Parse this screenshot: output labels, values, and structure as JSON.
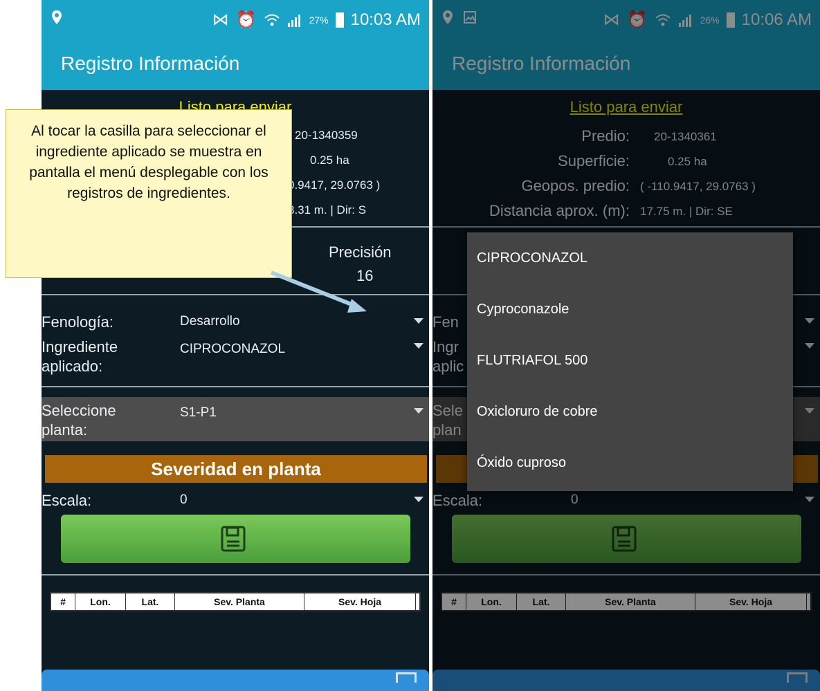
{
  "annotation": {
    "text": "Al tocar la casilla para seleccionar el ingrediente aplicado se muestra en pantalla el menú desplegable con los registros de ingredientes."
  },
  "phone1": {
    "status": {
      "battery": "27%",
      "time": "10:03 AM"
    },
    "app_title": "Registro Información",
    "ready_text": "Listo para enviar",
    "info": {
      "predio_value": "20-1340359",
      "superficie_value": "0.25 ha",
      "geopos_value": "0.9417, 29.0763 )",
      "distancia_value": "8.31 m. | Dir: S"
    },
    "precision": {
      "label": "Precisión",
      "value": "16"
    },
    "form": {
      "fenologia_label": "Fenología:",
      "fenologia_value": "Desarrollo",
      "ingrediente_label_1": "Ingrediente",
      "ingrediente_label_2": "aplicado:",
      "ingrediente_value": "CIPROCONAZOL",
      "planta_label_1": "Seleccione",
      "planta_label_2": "planta:",
      "planta_value": "S1-P1"
    },
    "severity_banner": "Severidad en planta",
    "escala_label": "Escala:",
    "escala_value": "0",
    "table_headers": [
      "#",
      "Lon.",
      "Lat.",
      "Sev. Planta",
      "Sev. Hoja"
    ]
  },
  "phone2": {
    "status": {
      "battery": "26%",
      "time": "10:06 AM"
    },
    "app_title": "Registro Información",
    "ready_text": "Listo para enviar",
    "info": {
      "predio_label": "Predio:",
      "predio_value": "20-1340361",
      "superficie_label": "Superficie:",
      "superficie_value": "0.25 ha",
      "geopos_label": "Geopos. predio:",
      "geopos_value": "( -110.9417, 29.0763 )",
      "distancia_label": "Distancia aprox. (m):",
      "distancia_value": "17.75 m. | Dir: SE"
    },
    "form_partial": {
      "fenologia": "Fen",
      "ingrediente_1": "Ingr",
      "ingrediente_2": "aplic",
      "planta_1": "Sele",
      "planta_2": "plan"
    },
    "escala_label": "Escala:",
    "escala_value": "0",
    "dropdown_options": [
      "CIPROCONAZOL",
      "Cyproconazole",
      "FLUTRIAFOL 500",
      "Oxicloruro de cobre",
      "Óxido cuproso"
    ],
    "table_headers": [
      "#",
      "Lon.",
      "Lat.",
      "Sev. Planta",
      "Sev. Hoja"
    ]
  },
  "colors": {
    "app_bar": "#1aa4c8",
    "background": "#0c1b24",
    "ready_text": "#f0f000",
    "severity_banner": "#a8650c",
    "save_button": "#5fb548",
    "annotation_bg": "#fdf8c4"
  }
}
